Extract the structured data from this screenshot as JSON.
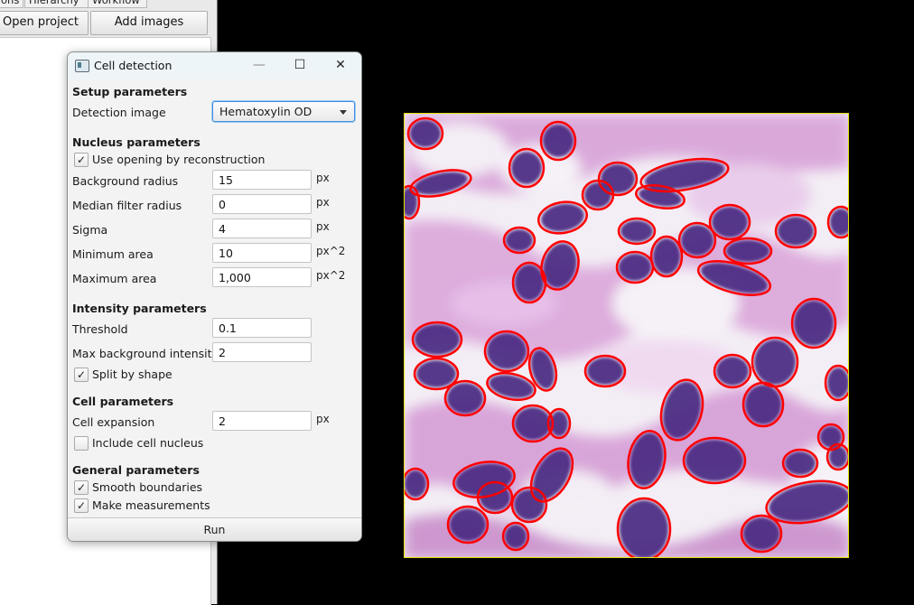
{
  "main_window": {
    "tabs": [
      "ons",
      "Hierarchy",
      "Workflow"
    ],
    "toolbar": {
      "open_project": "Open project",
      "add_images": "Add images"
    }
  },
  "dialog": {
    "title": "Cell detection",
    "controls": {
      "minimize": "—",
      "maximize": "☐",
      "close": "✕"
    },
    "setup": {
      "heading": "Setup parameters",
      "detection_image_label": "Detection image",
      "detection_image_value": "Hematoxylin OD"
    },
    "nucleus": {
      "heading": "Nucleus parameters",
      "opening_label": "Use opening by reconstruction",
      "opening_checked": true,
      "background_radius": {
        "label": "Background radius",
        "value": "15",
        "unit": "px"
      },
      "median_filter_radius": {
        "label": "Median filter radius",
        "value": "0",
        "unit": "px"
      },
      "sigma": {
        "label": "Sigma",
        "value": "4",
        "unit": "px"
      },
      "minimum_area": {
        "label": "Minimum area",
        "value": "10",
        "unit": "px^2"
      },
      "maximum_area": {
        "label": "Maximum area",
        "value": "1,000",
        "unit": "px^2"
      }
    },
    "intensity": {
      "heading": "Intensity parameters",
      "threshold": {
        "label": "Threshold",
        "value": "0.1"
      },
      "max_background": {
        "label": "Max background intensity",
        "value": "2"
      },
      "split_label": "Split by shape",
      "split_checked": true
    },
    "cell": {
      "heading": "Cell parameters",
      "expansion": {
        "label": "Cell expansion",
        "value": "2",
        "unit": "px"
      },
      "include_nucleus_label": "Include cell nucleus",
      "include_nucleus_checked": false
    },
    "general": {
      "heading": "General parameters",
      "smooth_label": "Smooth boundaries",
      "smooth_checked": true,
      "measurements_label": "Make measurements",
      "measurements_checked": true
    },
    "run_label": "Run"
  },
  "viewer": {
    "selection_color": "#e6e000",
    "detection_outline_color": "#ff0000",
    "nucleus_color": "#4a2a82",
    "tissue_color": "#d9a6d9"
  }
}
